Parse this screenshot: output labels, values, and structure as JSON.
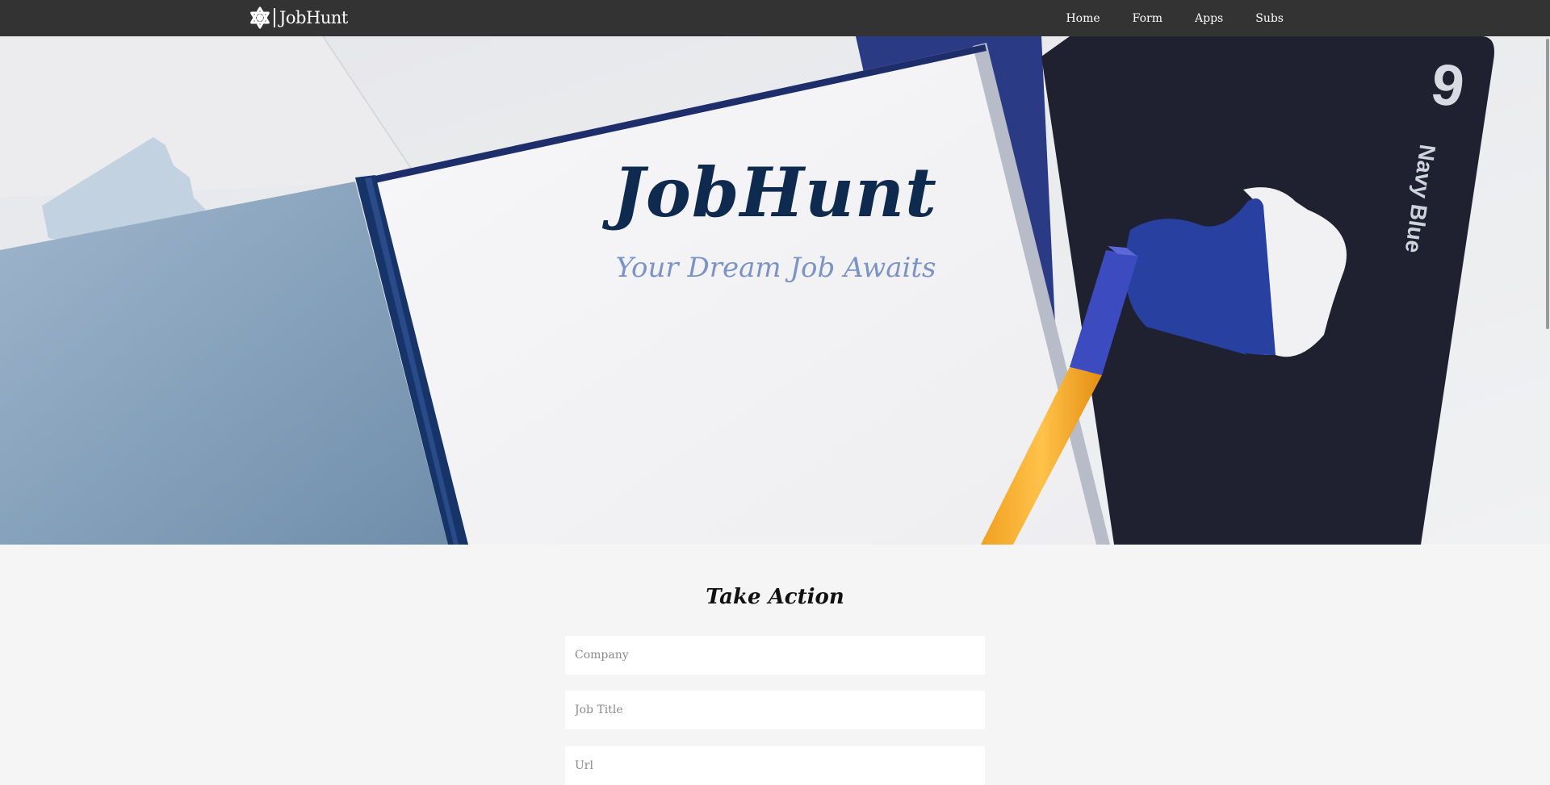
{
  "navbar": {
    "brand_text": "JobHunt",
    "brand_icon": "star-of-david-icon",
    "links": [
      {
        "label": "Home"
      },
      {
        "label": "Form"
      },
      {
        "label": "Apps"
      },
      {
        "label": "Subs"
      }
    ],
    "background": "#333333"
  },
  "hero": {
    "title": "JobHunt",
    "subtitle": "Your Dream Job Awaits",
    "title_color": "#0e2a4f",
    "subtitle_color": "#7b93c6",
    "card_number": "9",
    "card_label": "Navy Blue"
  },
  "form": {
    "title": "Take Action",
    "fields": {
      "company": {
        "placeholder": "Company",
        "value": ""
      },
      "job_title": {
        "placeholder": "Job Title",
        "value": ""
      },
      "url": {
        "placeholder": "Url",
        "value": ""
      }
    }
  }
}
